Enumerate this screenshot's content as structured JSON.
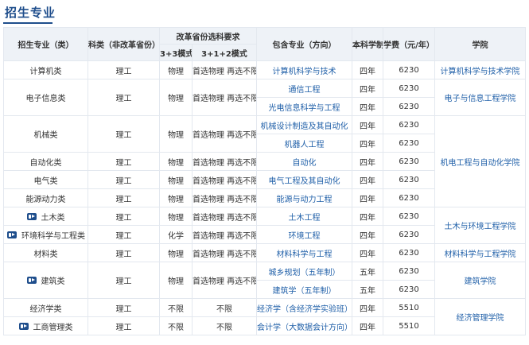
{
  "page_title": "招生专业",
  "headers": {
    "major_category": "招生专业（类）",
    "subject_type": "科类（非改革省份）",
    "reform_group": "改革省份选科要求",
    "mode_33": "3+3模式",
    "mode_312": "3+1+2模式",
    "included_majors": "包含专业（方向）",
    "duration": "本科学制",
    "tuition": "学费（元/年）",
    "college": "学院"
  },
  "rows": [
    {
      "category": "计算机类",
      "video": false,
      "subject": "理工",
      "m33": "物理",
      "m312": "首选物理 再选不限",
      "major": "计算机科学与技术",
      "duration": "四年",
      "tuition": "6230",
      "college": "计算机科学与技术学院"
    },
    {
      "category": "电子信息类",
      "video": false,
      "subject": "理工",
      "m33": "物理",
      "m312": "首选物理 再选不限",
      "major": "通信工程",
      "duration": "四年",
      "tuition": "6230",
      "college": "电子与信息工程学院"
    },
    {
      "major": "光电信息科学与工程",
      "duration": "四年",
      "tuition": "6230"
    },
    {
      "category": "机械类",
      "video": false,
      "subject": "理工",
      "m33": "物理",
      "m312": "首选物理 再选不限",
      "major": "机械设计制造及其自动化",
      "duration": "四年",
      "tuition": "6230",
      "college": "机电工程与自动化学院"
    },
    {
      "major": "机器人工程",
      "duration": "四年",
      "tuition": "6230"
    },
    {
      "category": "自动化类",
      "video": false,
      "subject": "理工",
      "m33": "物理",
      "m312": "首选物理 再选不限",
      "major": "自动化",
      "duration": "四年",
      "tuition": "6230"
    },
    {
      "category": "电气类",
      "video": false,
      "subject": "理工",
      "m33": "物理",
      "m312": "首选物理 再选不限",
      "major": "电气工程及其自动化",
      "duration": "四年",
      "tuition": "6230"
    },
    {
      "category": "能源动力类",
      "video": false,
      "subject": "理工",
      "m33": "物理",
      "m312": "首选物理 再选不限",
      "major": "能源与动力工程",
      "duration": "四年",
      "tuition": "6230"
    },
    {
      "category": "土木类",
      "video": true,
      "subject": "理工",
      "m33": "物理",
      "m312": "首选物理 再选不限",
      "major": "土木工程",
      "duration": "四年",
      "tuition": "6230",
      "college": "土木与环境工程学院"
    },
    {
      "category": "环境科学与工程类",
      "video": true,
      "subject": "理工",
      "m33": "化学",
      "m312": "首选物理 再选不限",
      "major": "环境工程",
      "duration": "四年",
      "tuition": "6230"
    },
    {
      "category": "材料类",
      "video": false,
      "subject": "理工",
      "m33": "物理",
      "m312": "首选物理 再选不限",
      "major": "材料科学与工程",
      "duration": "四年",
      "tuition": "6230",
      "college": "材料科学与工程学院"
    },
    {
      "category": "建筑类",
      "video": true,
      "subject": "理工",
      "m33": "物理",
      "m312": "首选物理 再选不限",
      "major": "城乡规划（五年制）",
      "duration": "五年",
      "tuition": "6230",
      "college": "建筑学院"
    },
    {
      "major": "建筑学（五年制）",
      "duration": "五年",
      "tuition": "6230"
    },
    {
      "category": "经济学类",
      "video": false,
      "subject": "理工",
      "m33": "不限",
      "m312": "不限",
      "major": "经济学（含经济学实验班）",
      "duration": "四年",
      "tuition": "5510",
      "college": "经济管理学院"
    },
    {
      "category": "工商管理类",
      "video": true,
      "subject": "理工",
      "m33": "不限",
      "m312": "不限",
      "major": "会计学（大数据会计方向）",
      "duration": "四年",
      "tuition": "5510"
    }
  ]
}
